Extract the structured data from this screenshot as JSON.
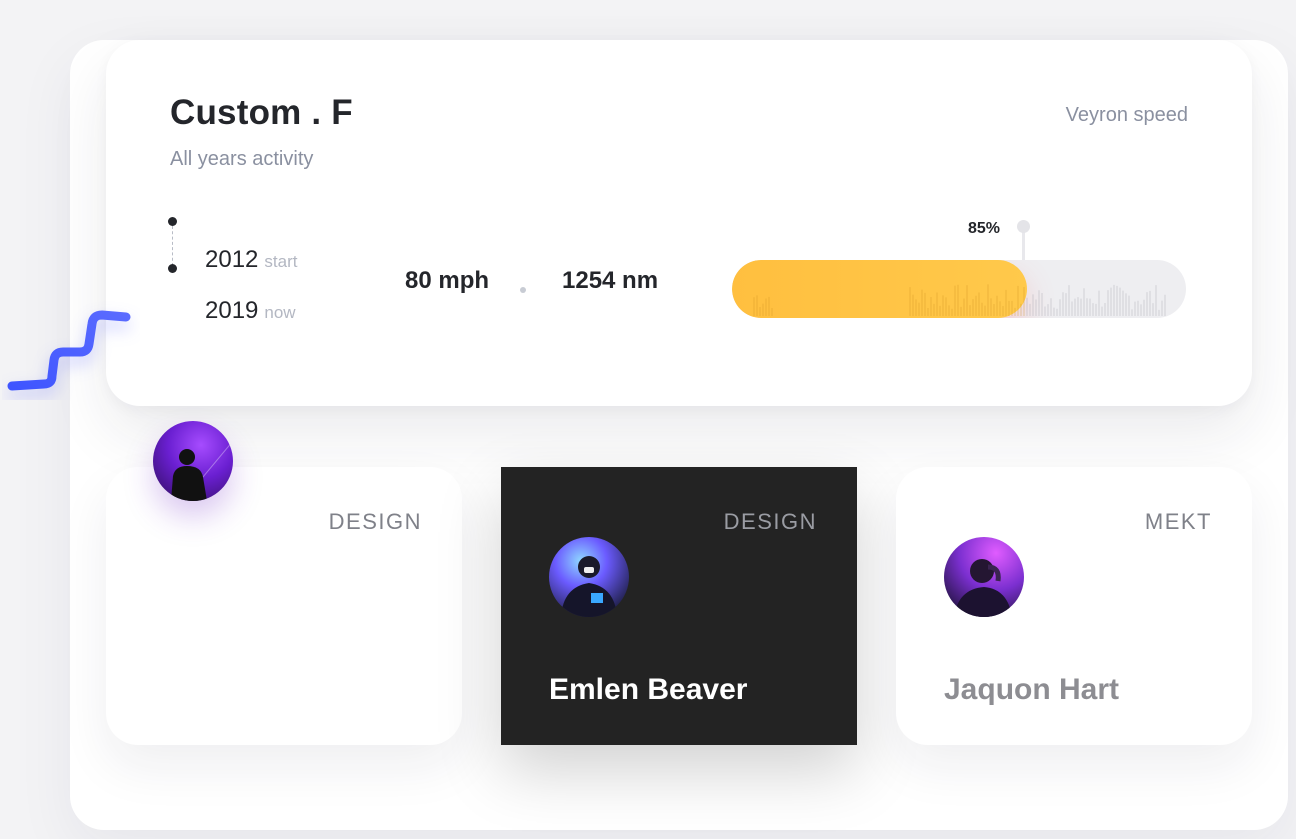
{
  "header": {
    "title": "Custom . F",
    "subtitle": "All years activity",
    "right_label": "Veyron speed"
  },
  "timeline": {
    "start_year": "2012",
    "start_tag": "start",
    "end_year": "2019",
    "end_tag": "now"
  },
  "stats": {
    "speed": "80 mph",
    "distance": "1254 nm"
  },
  "progress": {
    "percent_label": "85%",
    "fill_fraction": 0.65,
    "fill_color": "#ffc244",
    "track_color": "#eeeef1"
  },
  "cards": [
    {
      "tag": "DESIGN",
      "name": "",
      "avatar_icon": "person-silhouette-avatar"
    },
    {
      "tag": "DESIGN",
      "name": "Emlen Beaver",
      "avatar_icon": "person-avatar"
    },
    {
      "tag": "MEKT",
      "name": "Jaquon Hart",
      "avatar_icon": "person-avatar"
    }
  ],
  "colors": {
    "accent_blue": "#4c5cff",
    "dark_card": "#232323"
  }
}
